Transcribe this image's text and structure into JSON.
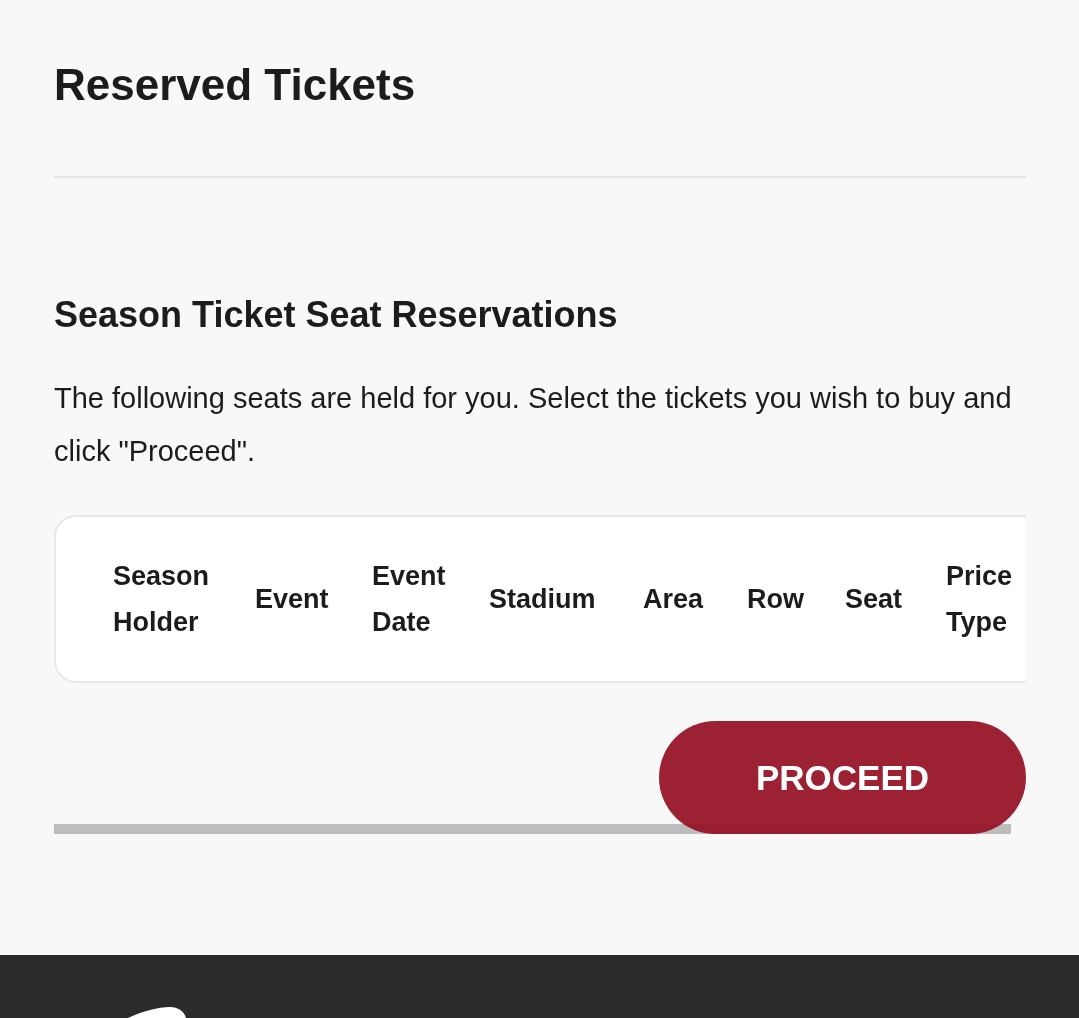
{
  "page_title": "Reserved Tickets",
  "section": {
    "title": "Season Ticket Seat Reservations",
    "description": "The following seats are held for you. Select the tickets you wish to buy and click \"Proceed\"."
  },
  "table": {
    "columns": [
      {
        "label": "Season Holder"
      },
      {
        "label": "Event"
      },
      {
        "label": "Event Date"
      },
      {
        "label": "Stadium"
      },
      {
        "label": "Area"
      },
      {
        "label": "Row"
      },
      {
        "label": "Seat"
      },
      {
        "label": "Price Type"
      }
    ]
  },
  "buttons": [
    {
      "label": "PROCEED"
    }
  ]
}
